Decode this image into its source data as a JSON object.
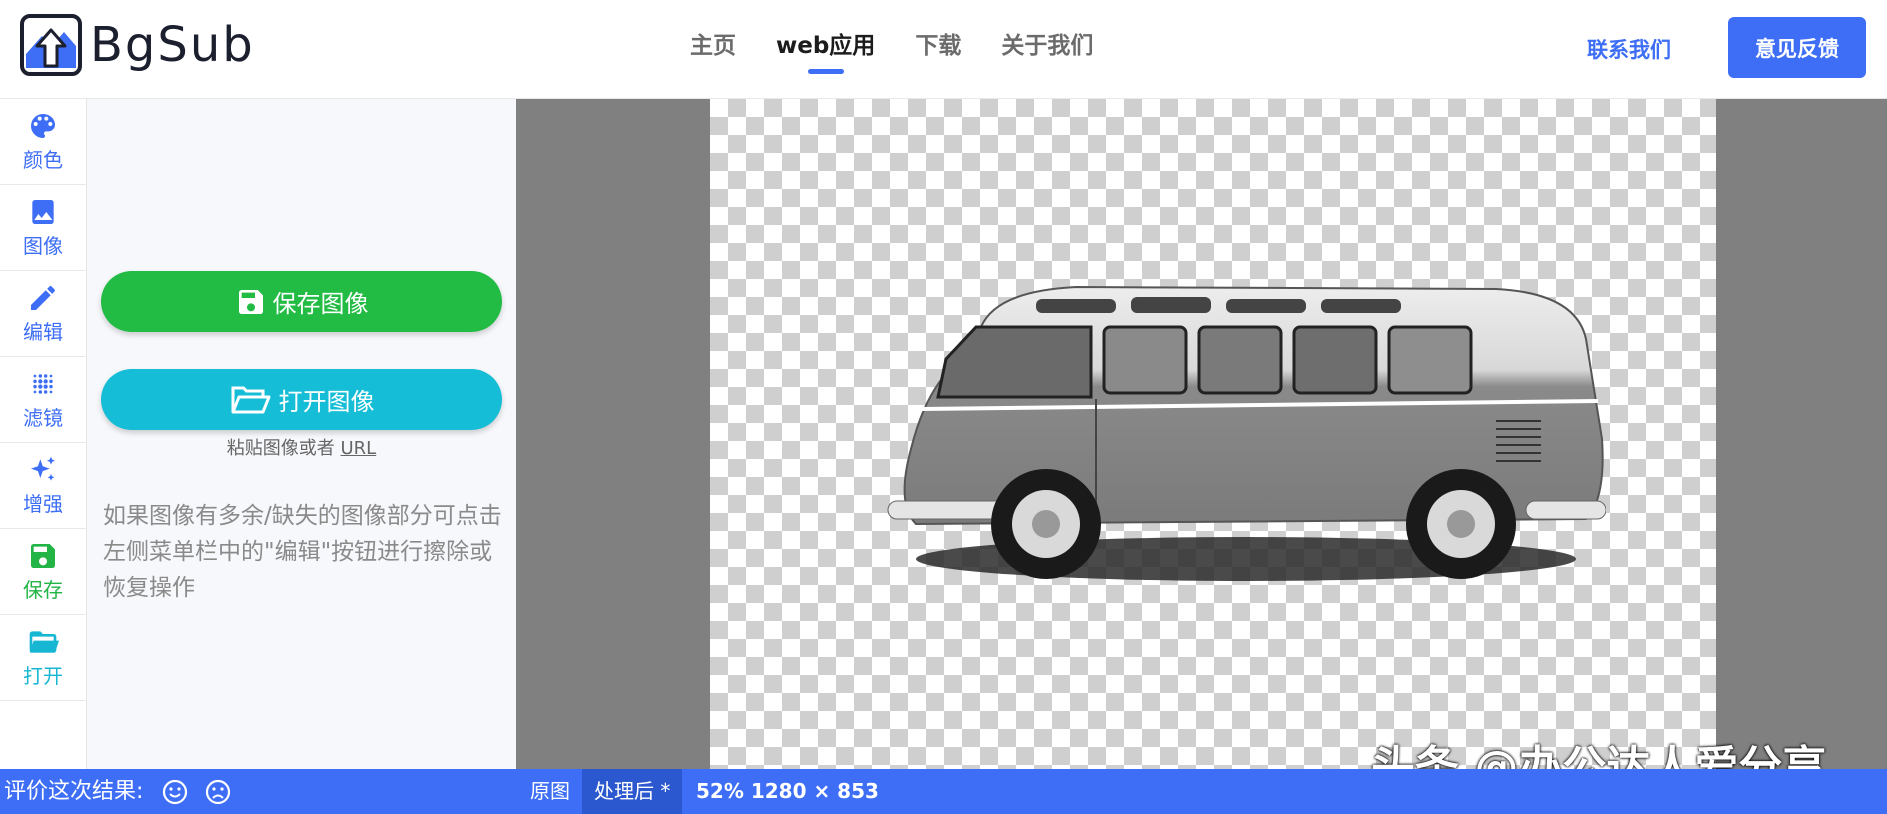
{
  "header": {
    "logo_text": "BgSub",
    "nav": [
      {
        "label": "主页"
      },
      {
        "label": "web应用"
      },
      {
        "label": "下载"
      },
      {
        "label": "关于我们"
      }
    ],
    "contact_label": "联系我们",
    "feedback_label": "意见反馈",
    "accent_color": "#3d6ef5"
  },
  "rail": {
    "items": [
      {
        "label": "颜色",
        "icon": "palette-icon"
      },
      {
        "label": "图像",
        "icon": "image-icon"
      },
      {
        "label": "编辑",
        "icon": "pencil-icon"
      },
      {
        "label": "滤镜",
        "icon": "dots-grid-icon"
      },
      {
        "label": "增强",
        "icon": "sparkles-icon"
      },
      {
        "label": "保存",
        "icon": "floppy-disk-icon"
      },
      {
        "label": "打开",
        "icon": "folder-open-icon"
      }
    ]
  },
  "panel": {
    "save_label": "保存图像",
    "open_label": "打开图像",
    "paste_hint": "粘贴图像或者",
    "paste_url": "URL",
    "tip": "如果图像有多余/缺失的图像部分可点击左侧菜单栏中的\"编辑\"按钮进行擦除或恢复操作",
    "save_color": "#22bb44",
    "open_color": "#16bdd6"
  },
  "canvas": {
    "watermark": "头条 @办公达人爱分享"
  },
  "bottom": {
    "rate_label": "评价这次结果:",
    "tab_original": "原图",
    "tab_processed": "处理后 *",
    "image_info": "52% 1280 × 853"
  }
}
